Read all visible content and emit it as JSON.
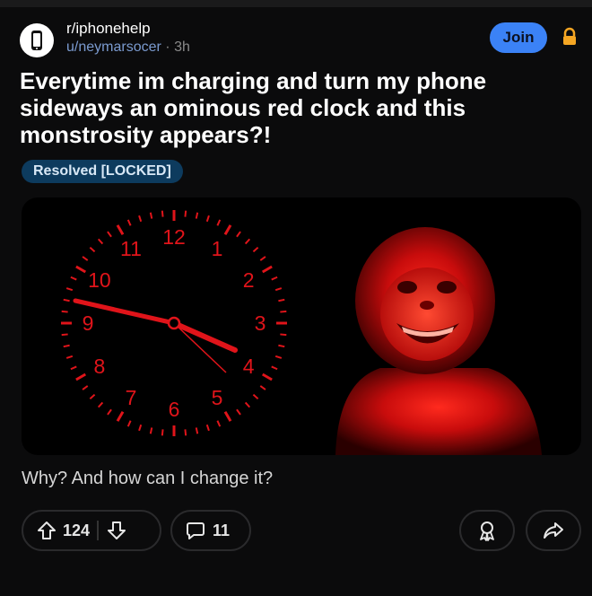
{
  "post": {
    "subreddit": "r/iphonehelp",
    "username": "u/neymarsocer",
    "separator": "·",
    "time": "3h",
    "join_label": "Join",
    "title": "Everytime im charging and turn my phone sideways an ominous red clock and this monstrosity appears?!",
    "flair": "Resolved [LOCKED]",
    "body": "Why? And how can I change it?"
  },
  "clock": {
    "numerals": [
      "12",
      "1",
      "2",
      "3",
      "4",
      "5",
      "6",
      "7",
      "8",
      "9",
      "10",
      "11"
    ],
    "color": "#e0141a"
  },
  "actions": {
    "upvotes": "124",
    "comments": "11"
  },
  "colors": {
    "accent": "#3b82f6",
    "flair_bg": "#0d3b5e",
    "lock": "#f5a623",
    "clock_red": "#e0141a"
  }
}
